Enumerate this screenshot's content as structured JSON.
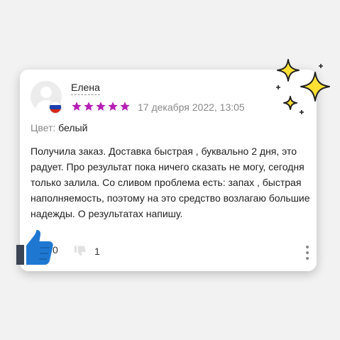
{
  "review": {
    "author": "Елена",
    "rating": 5,
    "rating_max": 5,
    "star_color": "#b620b4",
    "date": "17 декабря 2022, 13:05",
    "color_label": "Цвет:",
    "color_value": "белый",
    "text": "Получила заказ. Доставка быстрая , буквально 2 дня, это радует. Про результат пока ничего сказать не могу, сегодня только залила. Со сливом проблема есть: запах , быстрая наполняемость, поэтому на это средство возлагаю большие надежды. О результатах напишу.",
    "likes": "0",
    "dislikes": "1"
  },
  "icons": {
    "avatar": "user-avatar-placeholder",
    "flag": "russia-flag",
    "like": "thumbs-up-icon",
    "dislike": "thumbs-down-icon",
    "more": "more-vertical-icon",
    "decoration": "sparkles-icon"
  },
  "colors": {
    "page_bg": "#f2f2f2",
    "card_bg": "#ffffff",
    "thumb_blue": "#1e78d2",
    "sparkle_yellow": "#ffe033"
  }
}
